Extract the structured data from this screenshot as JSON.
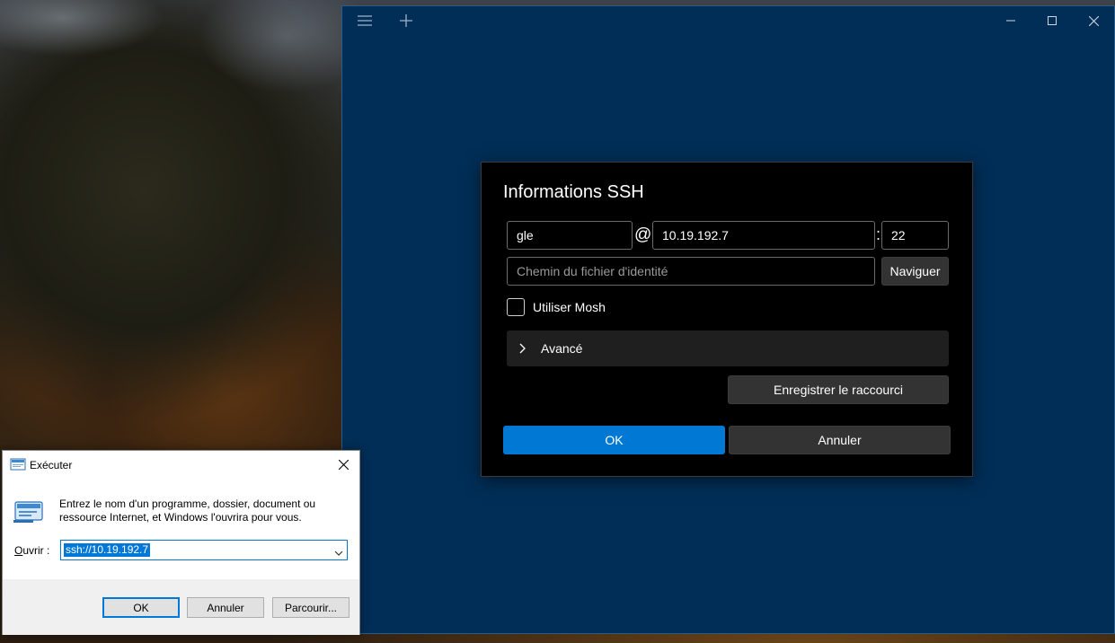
{
  "terminal_window": {
    "background_color": "#002e57",
    "title_bar_icons": [
      "hamburger-menu-icon",
      "plus-icon",
      "minimize-icon",
      "maximize-icon",
      "close-icon"
    ]
  },
  "ssh_dialog": {
    "title": "Informations SSH",
    "username": "gle",
    "at_separator": "@",
    "host": "10.19.192.7",
    "port_separator": ":",
    "port": "22",
    "identity_placeholder": "Chemin du fichier d'identité",
    "browse_label": "Naviguer",
    "mosh_label": "Utiliser Mosh",
    "mosh_checked": false,
    "advanced_label": "Avancé",
    "save_shortcut_label": "Enregistrer le raccourci",
    "ok_label": "OK",
    "cancel_label": "Annuler",
    "accent_color": "#0078d4"
  },
  "run_dialog": {
    "title": "Exécuter",
    "description": "Entrez le nom d'un programme, dossier, document ou ressource Internet, et Windows l'ouvrira pour vous.",
    "open_label": "Ouvrir :",
    "open_value": "ssh://10.19.192.7",
    "ok_label": "OK",
    "cancel_label": "Annuler",
    "browse_label": "Parcourir..."
  }
}
